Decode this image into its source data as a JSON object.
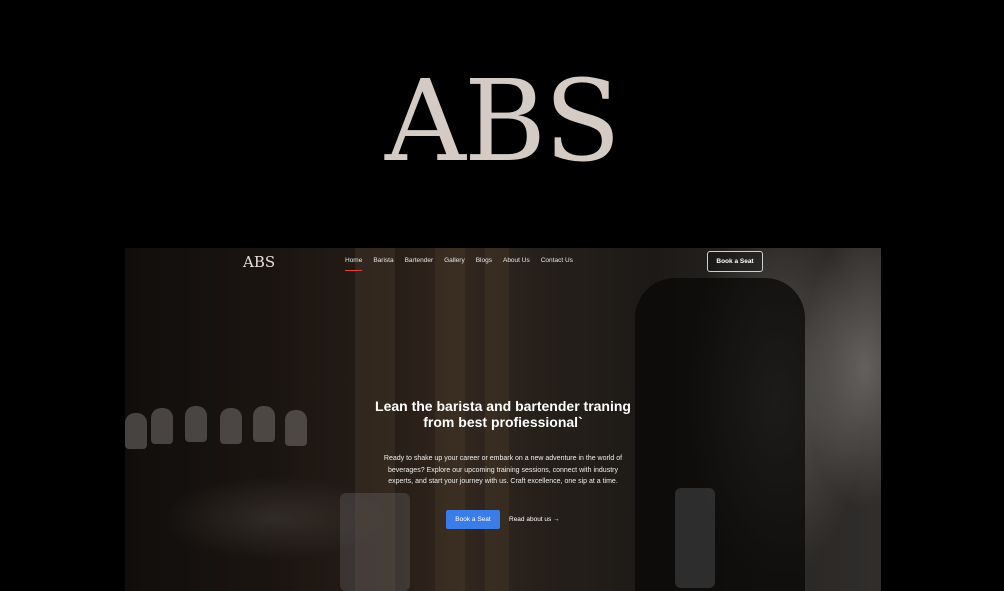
{
  "brand": {
    "logo_text": "ABS"
  },
  "nav": {
    "logo_text": "ABS",
    "links": [
      {
        "label": "Home"
      },
      {
        "label": "Barista"
      },
      {
        "label": "Bartender"
      },
      {
        "label": "Gallery"
      },
      {
        "label": "Blogs"
      },
      {
        "label": "About Us"
      },
      {
        "label": "Contact Us"
      }
    ],
    "cta_label": "Book a Seat"
  },
  "hero": {
    "title": "Lean the barista and bartender traning\nfrom best profiessional`",
    "description": "Ready to shake up your career or embark on a new adventure in the world of beverages? Explore our upcoming training sessions, connect with industry experts, and start your journey with us. Craft excellence, one sip at a time.",
    "primary_button": "Book a Seat",
    "secondary_link": "Read about us →"
  },
  "colors": {
    "accent": "#3b7de8",
    "active_underline": "#e04040",
    "logo": "#d4cbc5"
  }
}
